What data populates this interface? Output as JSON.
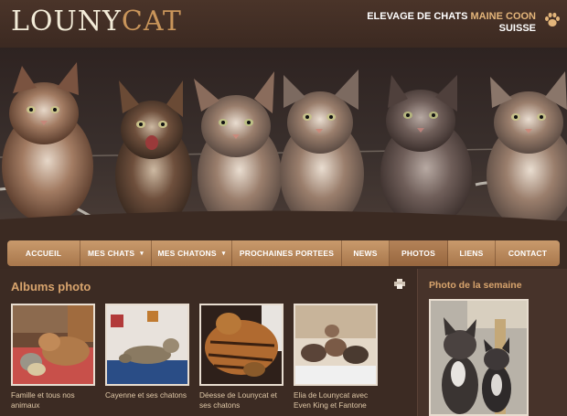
{
  "logo": {
    "part1": "LOUNY",
    "part2": "CAT"
  },
  "tagline": {
    "line1_prefix": "ELEVAGE DE CHATS ",
    "line1_accent": "MAINE COON",
    "line2": "SUISSE"
  },
  "nav": [
    {
      "label": "ACCUEIL",
      "dropdown": false
    },
    {
      "label": "MES CHATS",
      "dropdown": true
    },
    {
      "label": "MES CHATONS",
      "dropdown": true
    },
    {
      "label": "PROCHAINES PORTEES",
      "dropdown": false
    },
    {
      "label": "NEWS",
      "dropdown": false
    },
    {
      "label": "PHOTOS",
      "dropdown": false,
      "active": true
    },
    {
      "label": "LIENS",
      "dropdown": false
    },
    {
      "label": "CONTACT",
      "dropdown": false
    }
  ],
  "albums": {
    "title": "Albums photo",
    "items": [
      {
        "caption": "Famille et tous nos animaux"
      },
      {
        "caption": "Cayenne et ses chatons"
      },
      {
        "caption": "Déesse de Lounycat et ses chatons"
      },
      {
        "caption": "Elia de Lounycat avec Even King et Fantone"
      }
    ]
  },
  "sidebar": {
    "title": "Photo de la semaine"
  },
  "colors": {
    "background": "#3b2a22",
    "accent": "#d8a46d",
    "nav": "#b88a5e"
  },
  "icons": {
    "logo_mark": "paw-icon",
    "print": "print-icon"
  }
}
